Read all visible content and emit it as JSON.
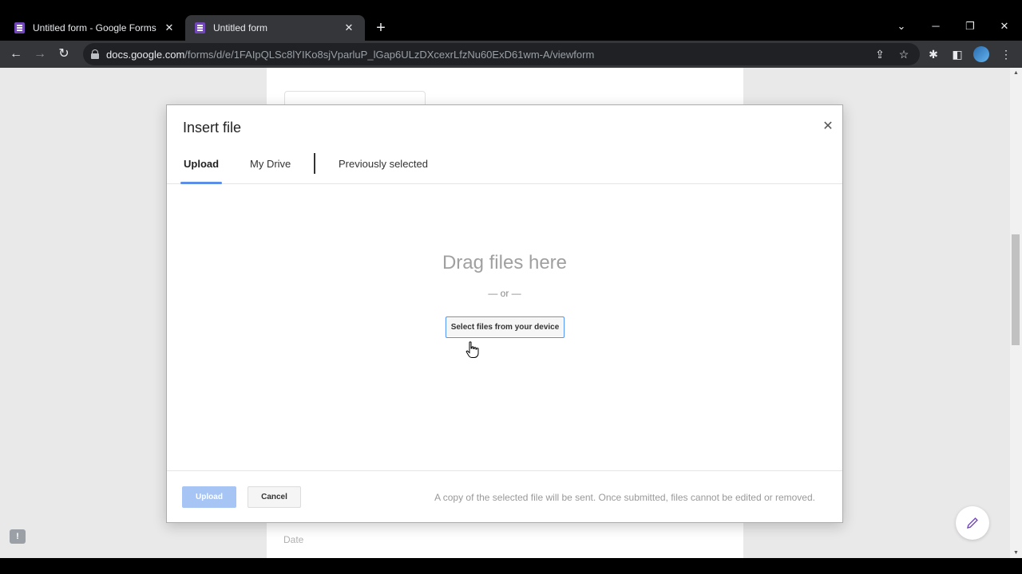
{
  "browser": {
    "tabs": [
      {
        "title": "Untitled form - Google Forms",
        "active": false
      },
      {
        "title": "Untitled form",
        "active": true
      }
    ],
    "url_host": "docs.google.com",
    "url_path": "/forms/d/e/1FAIpQLSc8lYIKo8sjVparluP_lGap6ULzDXcexrLfzNu60ExD61wm-A/viewform"
  },
  "form": {
    "date_label": "Date"
  },
  "dialog": {
    "title": "Insert file",
    "tabs": [
      {
        "label": "Upload",
        "active": true
      },
      {
        "label": "My Drive",
        "active": false
      },
      {
        "label": "Previously selected",
        "active": false
      }
    ],
    "drag_text": "Drag files here",
    "or_text": "— or —",
    "select_button": "Select files from your device",
    "upload_button": "Upload",
    "cancel_button": "Cancel",
    "footer_note": "A copy of the selected file will be sent. Once submitted, files cannot be edited or removed."
  },
  "colors": {
    "accent_blue": "#5c8ee6",
    "upload_disabled": "#a7c5f4",
    "forms_purple": "#7248b9"
  }
}
